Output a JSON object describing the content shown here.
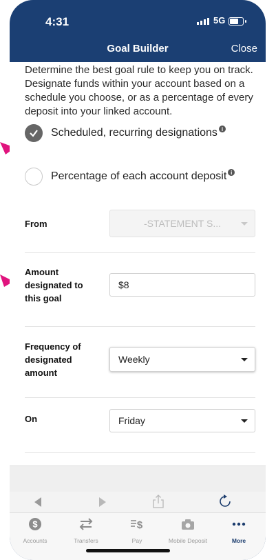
{
  "status": {
    "time": "4:31",
    "network": "5G"
  },
  "nav": {
    "title": "Goal Builder",
    "close_label": "Close"
  },
  "intro_text": "Determine the best goal rule to keep you on track. Designate funds within your account based on a schedule you choose, or as a percentage of every deposit into your linked account.",
  "options": [
    {
      "label": "Scheduled, recurring designations",
      "selected": true
    },
    {
      "label": "Percentage of each account deposit",
      "selected": false
    }
  ],
  "form": {
    "from_label": "From",
    "from_value": "-STATEMENT S...",
    "amount_label": "Amount designated to this goal",
    "amount_value": "$8",
    "frequency_label": "Frequency of designated amount",
    "frequency_value": "Weekly",
    "on_label": "On",
    "on_value": "Friday"
  },
  "tabs": [
    {
      "label": "Accounts",
      "icon": "dollar-coin-icon"
    },
    {
      "label": "Transfers",
      "icon": "transfer-arrows-icon"
    },
    {
      "label": "Pay",
      "icon": "pay-icon"
    },
    {
      "label": "Mobile Deposit",
      "icon": "camera-icon"
    },
    {
      "label": "More",
      "icon": "more-dots-icon",
      "active": true
    }
  ],
  "colors": {
    "header": "#1b3f73",
    "annotation_arrow": "#e0147e",
    "active_tab": "#1c3d6e"
  }
}
